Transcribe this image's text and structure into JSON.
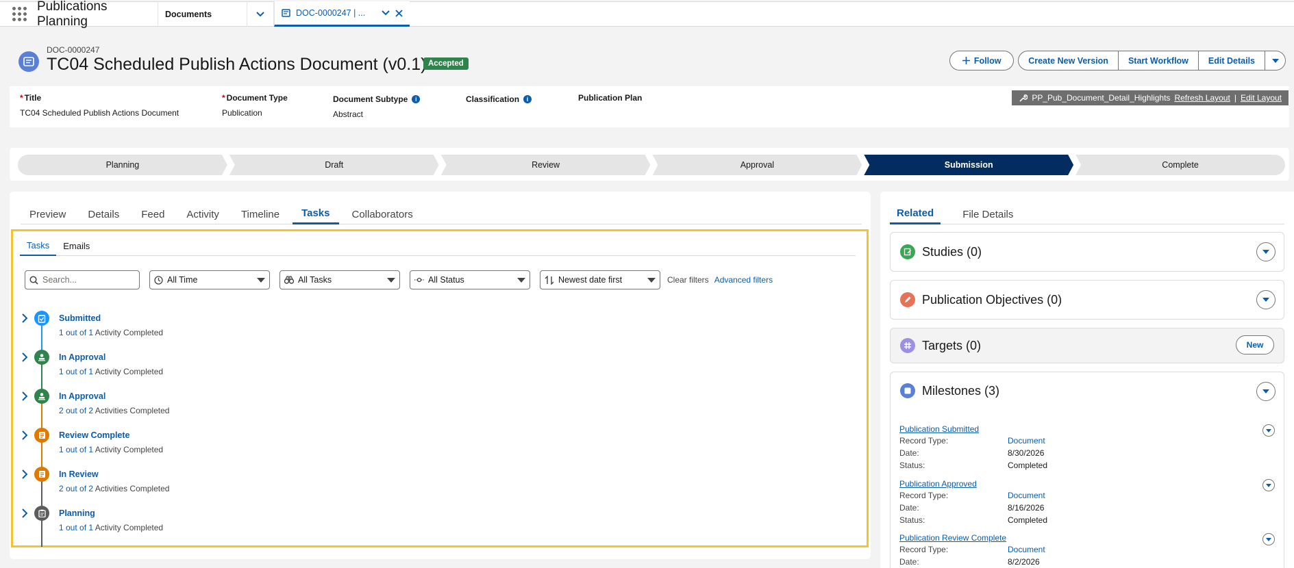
{
  "app": {
    "name": "Publications Planning"
  },
  "nav": {
    "documents_tab": "Documents",
    "record_tab": "DOC-0000247 | ..."
  },
  "record": {
    "id": "DOC-0000247",
    "title": "TC04 Scheduled Publish Actions Document (v0.1)",
    "status_badge": "Accepted",
    "buttons": {
      "follow": "Follow",
      "create_new_version": "Create New Version",
      "start_workflow": "Start Workflow",
      "edit_details": "Edit Details"
    }
  },
  "highlights": {
    "fields": [
      {
        "label": "Title",
        "value": "TC04 Scheduled Publish Actions Document",
        "required": "*"
      },
      {
        "label": "Document Type",
        "value": "Publication",
        "required": "*"
      },
      {
        "label": "Document Subtype",
        "value": "Abstract"
      },
      {
        "label": "Classification",
        "value": ""
      },
      {
        "label": "Publication Plan",
        "value": ""
      }
    ],
    "layout_name": "PP_Pub_Document_Detail_Highlights",
    "refresh_layout": "Refresh Layout",
    "separator": "|",
    "edit_layout": "Edit Layout"
  },
  "path": {
    "steps": [
      "Planning",
      "Draft",
      "Review",
      "Approval",
      "Submission",
      "Complete"
    ],
    "current": "Submission"
  },
  "main_tabs": [
    "Preview",
    "Details",
    "Feed",
    "Activity",
    "Timeline",
    "Tasks",
    "Collaborators"
  ],
  "main_active_tab": "Tasks",
  "sub_tabs": [
    "Tasks",
    "Emails"
  ],
  "filters": {
    "search_placeholder": "Search...",
    "time": "All Time",
    "tasks": "All Tasks",
    "status": "All Status",
    "sort": "Newest date first",
    "clear": "Clear filters",
    "advanced": "Advanced filters"
  },
  "timeline": [
    {
      "title": "Submitted",
      "count": "1 out of 1",
      "suffix": "Activity Completed",
      "color": "#1b96ff",
      "icon": "clipboard-check-icon"
    },
    {
      "title": "In Approval",
      "count": "1 out of 1",
      "suffix": "Activity Completed",
      "color": "#2e844a",
      "icon": "approval-stamp-icon"
    },
    {
      "title": "In Approval",
      "count": "2 out of 2",
      "suffix": "Activities Completed",
      "color": "#2e844a",
      "icon": "approval-stamp-icon"
    },
    {
      "title": "Review Complete",
      "count": "1 out of 1",
      "suffix": "Activity Completed",
      "color": "#dd7a01",
      "icon": "review-doc-icon"
    },
    {
      "title": "In Review",
      "count": "2 out of 2",
      "suffix": "Activities Completed",
      "color": "#dd7a01",
      "icon": "review-doc-icon"
    },
    {
      "title": "Planning",
      "count": "1 out of 1",
      "suffix": "Activity Completed",
      "color": "#5c5c5c",
      "icon": "clipboard-icon"
    }
  ],
  "right_tabs": [
    "Related",
    "File Details"
  ],
  "related": {
    "studies": "Studies (0)",
    "objectives": "Publication Objectives (0)",
    "targets": "Targets (0)",
    "targets_new": "New",
    "milestones": "Milestones (3)"
  },
  "milestones": [
    {
      "title": "Publication Submitted",
      "record_type_label": "Record Type:",
      "record_type": "Document",
      "date_label": "Date:",
      "date": "8/30/2026",
      "status_label": "Status:",
      "status": "Completed"
    },
    {
      "title": "Publication Approved",
      "record_type_label": "Record Type:",
      "record_type": "Document",
      "date_label": "Date:",
      "date": "8/16/2026",
      "status_label": "Status:",
      "status": "Completed"
    },
    {
      "title": "Publication Review Complete",
      "record_type_label": "Record Type:",
      "record_type": "Document",
      "date_label": "Date:",
      "date": "8/2/2026"
    }
  ]
}
